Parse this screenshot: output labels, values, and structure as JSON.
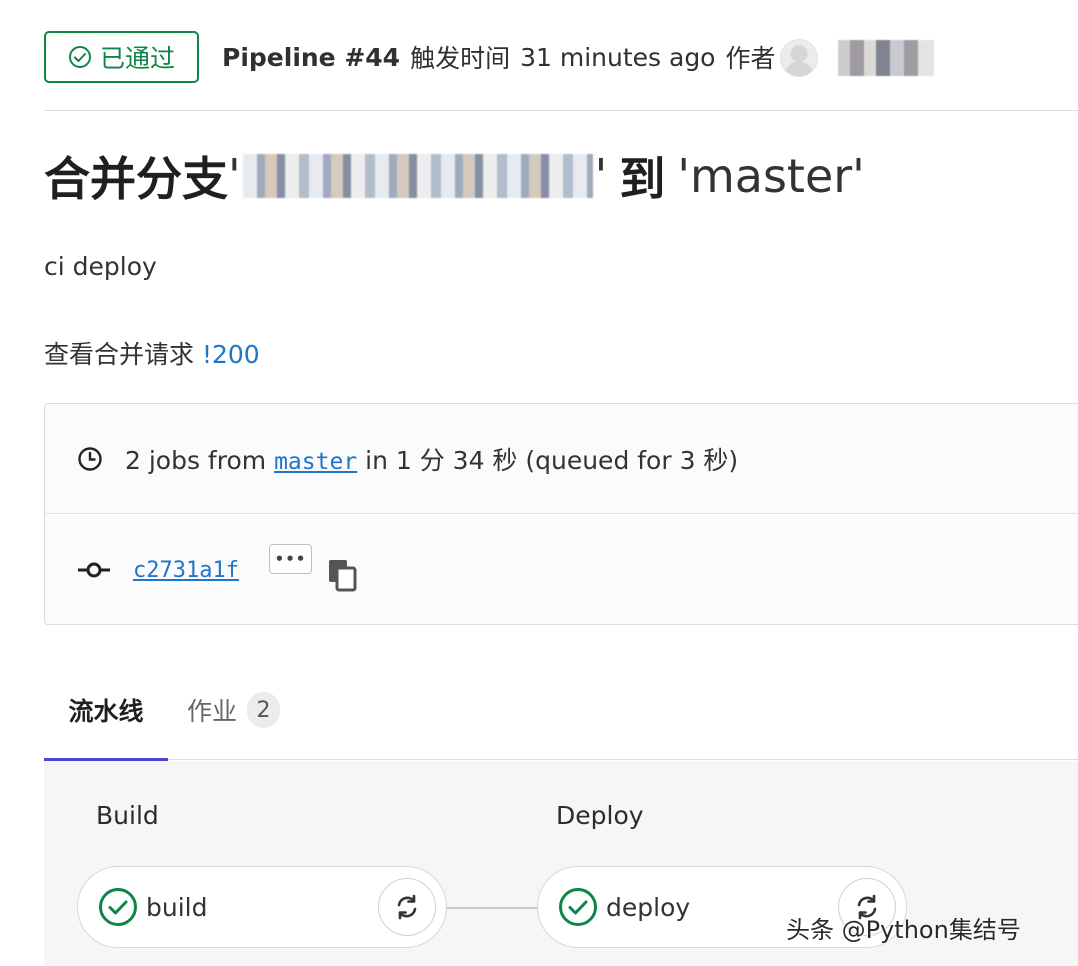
{
  "header": {
    "status_label": "已通过",
    "pipeline_id": "Pipeline #44",
    "triggered_label": "触发时间",
    "time_ago": "31 minutes ago",
    "author_label": "作者"
  },
  "title": {
    "prefix": "合并分支",
    "open_quote": "'",
    "close_quote": "'",
    "connector": "到",
    "target_branch": "'master'"
  },
  "description": "ci deploy",
  "merge_request": {
    "label": "查看合并请求",
    "link": "!200"
  },
  "info": {
    "jobs_prefix": "2 jobs from",
    "branch": "master",
    "jobs_suffix": "in 1 分 34 秒 (queued for 3 秒)",
    "commit_sha": "c2731a1f",
    "ellipsis": "•••"
  },
  "tabs": {
    "pipeline": "流水线",
    "jobs": "作业",
    "jobs_count": "2"
  },
  "stages": [
    {
      "title": "Build",
      "job": "build",
      "status": "success"
    },
    {
      "title": "Deploy",
      "job": "deploy",
      "status": "success"
    }
  ],
  "watermark": "头条 @Python集结号",
  "colors": {
    "success": "#108548",
    "link": "#1f75cb",
    "tab_indicator": "#4a47c9"
  },
  "icons": [
    "check-circle-icon",
    "clock-icon",
    "commit-icon",
    "copy-icon",
    "retry-icon"
  ]
}
